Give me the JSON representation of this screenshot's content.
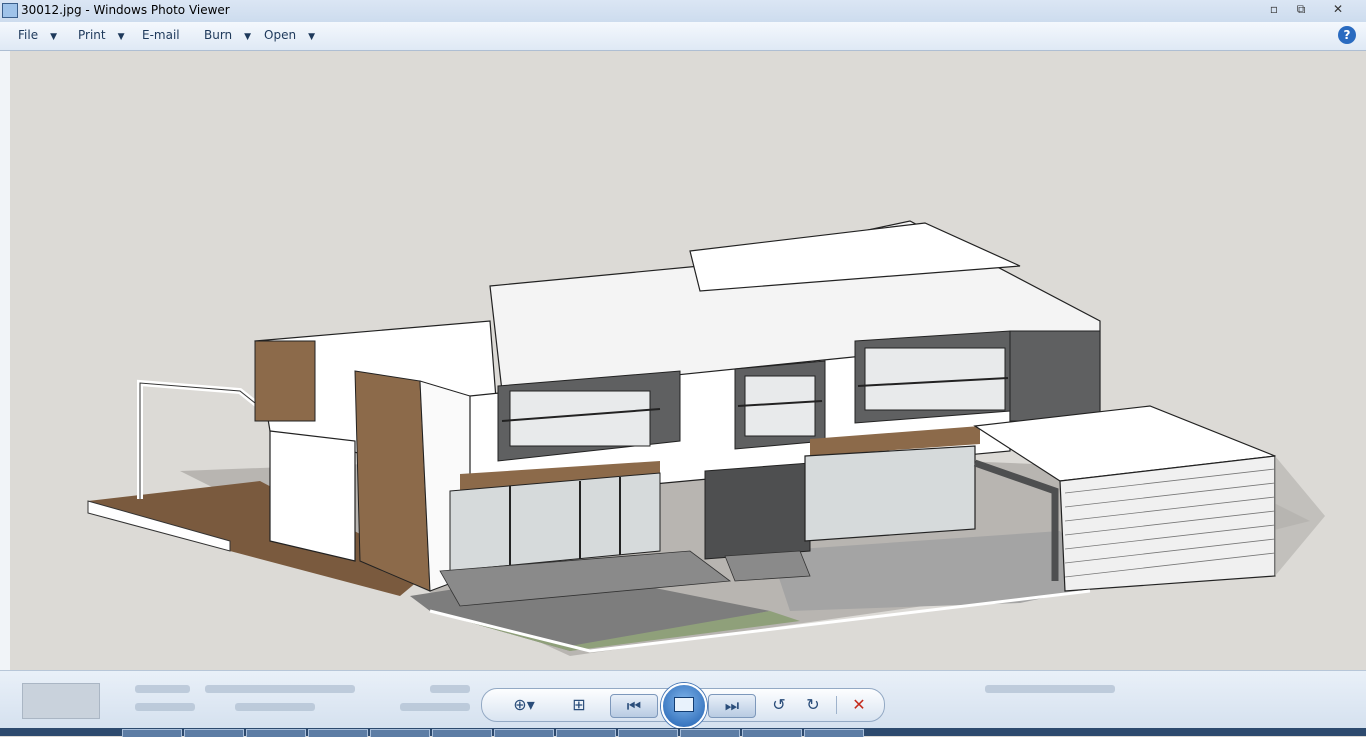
{
  "window": {
    "title": "30012.jpg - Windows Photo Viewer",
    "controls": [
      "minimize",
      "restore",
      "close"
    ]
  },
  "menu": {
    "items": [
      {
        "label": "File",
        "has_dropdown": true
      },
      {
        "label": "Print",
        "has_dropdown": true
      },
      {
        "label": "E-mail",
        "has_dropdown": false
      },
      {
        "label": "Burn",
        "has_dropdown": true
      },
      {
        "label": "Open",
        "has_dropdown": true
      }
    ],
    "help_label": "?"
  },
  "viewer": {
    "image_subject": "3D model rendering of a two-storey modern house with timber cladding, balconies and garage",
    "background_color": "#dcdad6"
  },
  "bottom_controls": {
    "zoom_icon": "magnifier-plus-icon",
    "fit_icon": "actual-size-icon",
    "previous_icon": "skip-previous-icon",
    "slideshow_icon": "slideshow-icon",
    "next_icon": "skip-next-icon",
    "rotate_ccw_icon": "rotate-counterclockwise-icon",
    "rotate_cw_icon": "rotate-clockwise-icon",
    "delete_icon": "delete-x-icon"
  },
  "colors": {
    "titlebar": "#cddcee",
    "menubar": "#dfe9f5",
    "accent": "#1f5fb0",
    "delete": "#c42b1c"
  }
}
